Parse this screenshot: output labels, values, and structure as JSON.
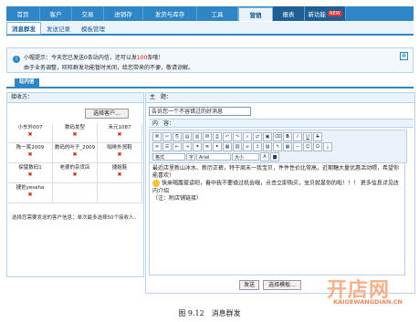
{
  "nav": {
    "items": [
      {
        "label": "首页"
      },
      {
        "label": "客户"
      },
      {
        "label": "交易"
      },
      {
        "label": "进销存"
      },
      {
        "label": "发货与库存"
      },
      {
        "label": "工具"
      },
      {
        "label": "营销"
      },
      {
        "label": "报表"
      },
      {
        "label": "新功能",
        "badge": "NEW"
      }
    ],
    "active": "营销"
  },
  "subnav": {
    "items": [
      "消息群发",
      "发送记录",
      "模板管理"
    ],
    "active": "消息群发"
  },
  "notice": {
    "line1_pre": "小帽提示：今天您已发送0条站内信，还可以发",
    "line1_num": "100",
    "line1_post": "条哦！",
    "line2": "由于业务调整，旺旺群发功能暂时关闭，给您带来的不便，敬请谅解。"
  },
  "tab": {
    "label": "站内信"
  },
  "receivers": {
    "header": "接收方：",
    "select_button": "选择客户...",
    "list": [
      "小东外007",
      "数码发型",
      "禾元1087",
      "陈一笑2009",
      "数码的叶子_2009",
      "咖啡外贸鞋",
      "探猛数码1",
      "老婆的杂货店",
      "捷姐鞋",
      "捷佐yesaha"
    ],
    "note": "选择您需要发送的客户信息；单次最多选择50个接收人。"
  },
  "message": {
    "subject_label": "主　题：",
    "subject_value": "告诉您一个不容错过的好消息",
    "content_label": "内　容：",
    "toolbar": {
      "style_label": "格式",
      "font_label": "字体",
      "font_value": "Arial",
      "size_label": "大小"
    },
    "body_line1": "最近店里新山冰水、新历正裤，特于周末一我宝贝，件件性价比常高，近期糖大量优惠活动喂，希望你能喜欢!",
    "body_line2": "快来喝露提读吧，看中我不要错过机会哦，点击立即购买，宝贝就是你的啦！！！ 更多信息详见店内介绍",
    "body_line3": "（注：附店铺链接）",
    "send_button": "发送",
    "template_button": "选择模板..."
  },
  "caption": "图 9.12　消息群发",
  "watermark": {
    "brand": "开店网",
    "url": "KAIGEWANGDIAN.CN"
  }
}
